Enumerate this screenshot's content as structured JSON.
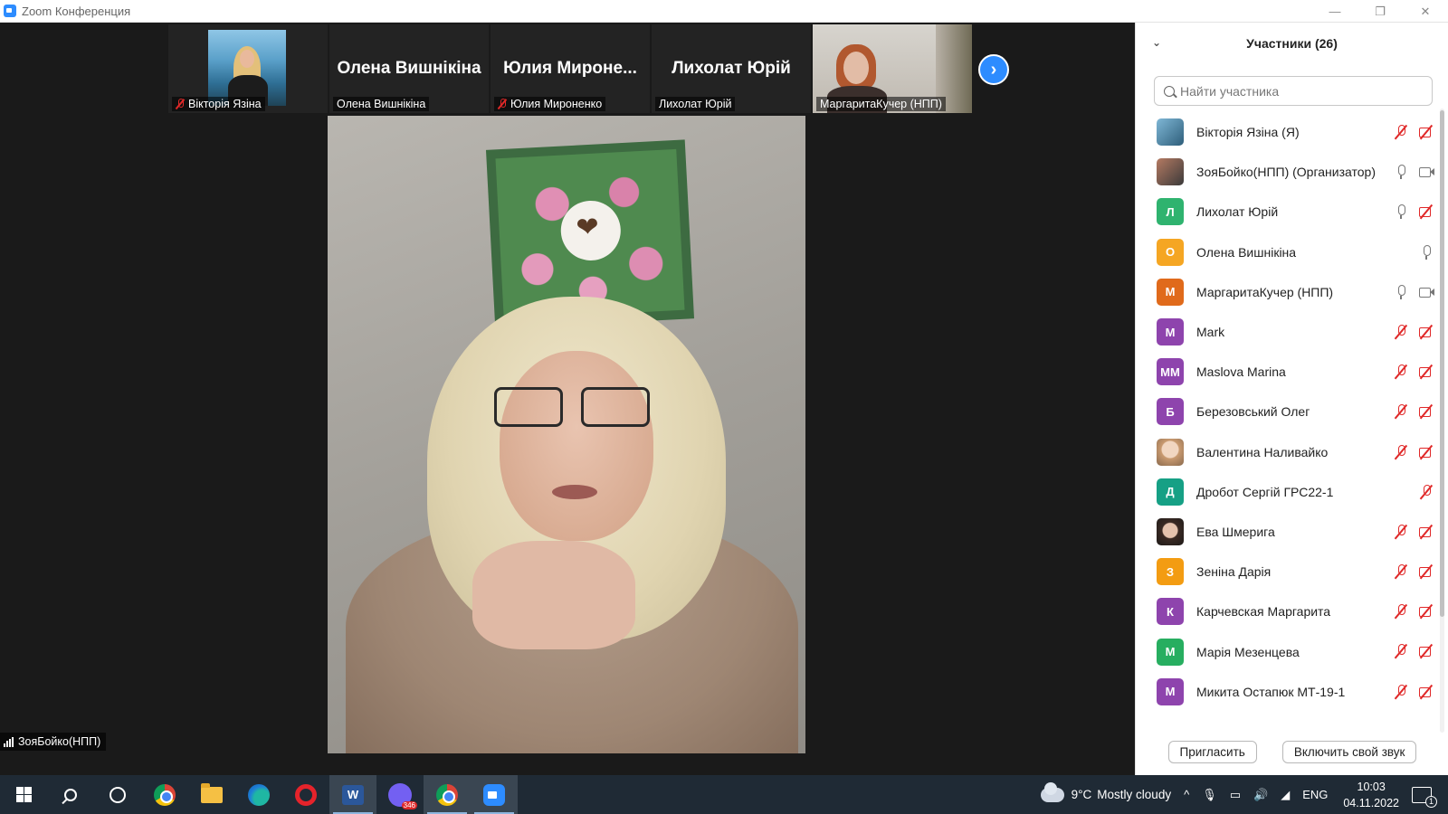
{
  "window": {
    "title": "Zoom Конференция",
    "controls": {
      "minimize": "—",
      "restore": "❐",
      "close": "✕"
    }
  },
  "thumbnails": [
    {
      "label": "Вікторія Язіна",
      "big_name": "",
      "muted": true,
      "has_video": true,
      "video_person": "viktoria"
    },
    {
      "label": "Олена Вишнікіна",
      "big_name": "Олена Вишнікіна",
      "muted": false,
      "has_video": false
    },
    {
      "label": "Юлия Мироненко",
      "big_name": "Юлия  Мироне...",
      "muted": true,
      "has_video": false
    },
    {
      "label": "Лихолат Юрій",
      "big_name": "Лихолат Юрій",
      "muted": false,
      "has_video": false
    },
    {
      "label": "МаргаритаКучер  (НПП)",
      "big_name": "",
      "muted": false,
      "has_video": true,
      "video_person": "margarita"
    }
  ],
  "next_button_icon": "chevron-right-icon",
  "main_video": {
    "speaker_label": "ЗояБойко(НПП)"
  },
  "participants_panel": {
    "title": "Участники (26)",
    "search_placeholder": "Найти участника",
    "participants": [
      {
        "initials": "",
        "avatar": "photo",
        "name": "Вікторія Язіна (Я)",
        "mic": "off",
        "cam": "off"
      },
      {
        "initials": "",
        "avatar": "photo2",
        "name": "ЗояБойко(НПП) (Организатор)",
        "mic": "on",
        "cam": "on"
      },
      {
        "initials": "Л",
        "color": "#2fb36f",
        "name": "Лихолат Юрій",
        "mic": "on",
        "cam": "off"
      },
      {
        "initials": "О",
        "color": "#f5a623",
        "name": "Олена Вишнікіна",
        "mic": "none",
        "cam": "on_only_mic"
      },
      {
        "initials": "М",
        "color": "#e06a1b",
        "name": "МаргаритаКучер  (НПП)",
        "mic": "on",
        "cam": "on"
      },
      {
        "initials": "М",
        "color": "#8e44ad",
        "name": "Mark",
        "mic": "off",
        "cam": "off"
      },
      {
        "initials": "MM",
        "color": "#8e44ad",
        "name": "Maslova Marina",
        "mic": "off",
        "cam": "off"
      },
      {
        "initials": "Б",
        "color": "#8e44ad",
        "name": "Березовський Олег",
        "mic": "off",
        "cam": "off"
      },
      {
        "initials": "",
        "avatar": "photo3",
        "name": "Валентина Наливайко",
        "mic": "off",
        "cam": "off"
      },
      {
        "initials": "Д",
        "color": "#16a085",
        "name": "Дробот Сергій ГРС22-1",
        "mic": "none",
        "cam": "off_only_mic"
      },
      {
        "initials": "",
        "avatar": "photo4",
        "name": "Ева Шмерига",
        "mic": "off",
        "cam": "off"
      },
      {
        "initials": "З",
        "color": "#f39c12",
        "name": "Зеніна Дарія",
        "mic": "off",
        "cam": "off"
      },
      {
        "initials": "К",
        "color": "#8e44ad",
        "name": "Карчевская Маргарита",
        "mic": "off",
        "cam": "off"
      },
      {
        "initials": "М",
        "color": "#27ae60",
        "name": "Марія Мезенцева",
        "mic": "off",
        "cam": "off"
      },
      {
        "initials": "М",
        "color": "#8e44ad",
        "name": "Микита Остапюк МТ-19-1",
        "mic": "off",
        "cam": "off"
      }
    ],
    "invite_button": "Пригласить",
    "unmute_button": "Включить свой звук"
  },
  "taskbar": {
    "apps": [
      "windows-start",
      "search",
      "cortana",
      "chrome",
      "file-explorer",
      "edge",
      "opera",
      "word",
      "viber",
      "chrome-profile",
      "zoom"
    ],
    "viber_badge": "346",
    "word_letter": "W",
    "weather": {
      "temp": "9°C",
      "condition": "Mostly cloudy"
    },
    "language": "ENG",
    "time": "10:03",
    "date": "04.11.2022",
    "notifications": "1"
  }
}
